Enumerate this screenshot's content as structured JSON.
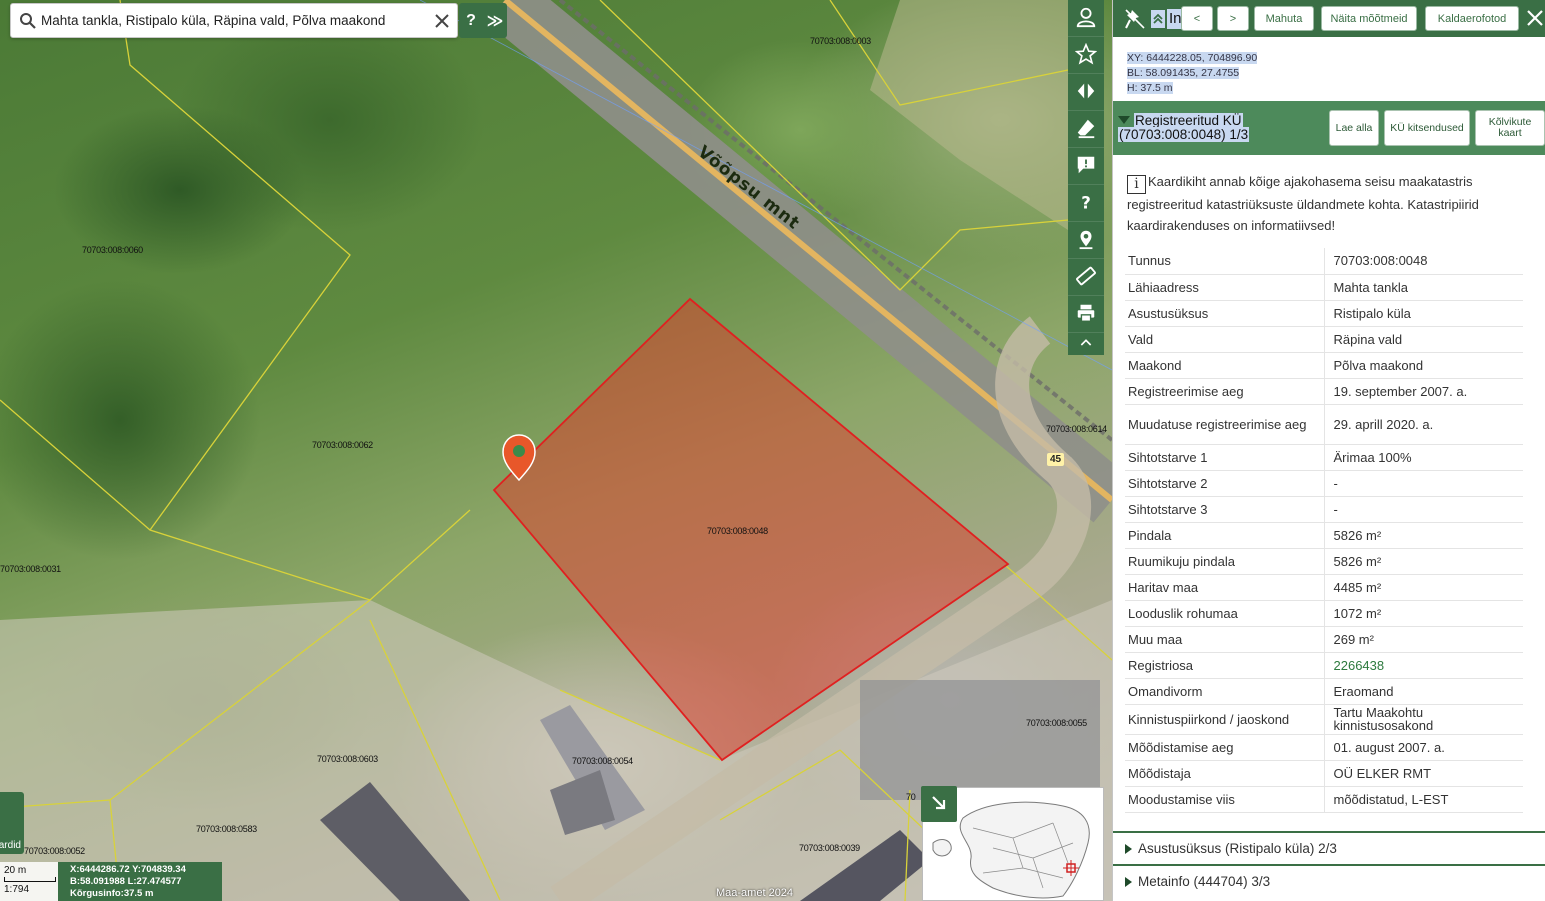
{
  "search": {
    "value": "Mahta tankla, Ristipalo küla, Räpina vald, Põlva maakond",
    "help": "?",
    "expand": "≫"
  },
  "map": {
    "road_name": "Võõpsu mnt",
    "road_number": "45",
    "attribution": "Maa-amet 2024",
    "parcels": [
      "70703:008:0003",
      "70703:008:0060",
      "70703:008:0062",
      "70703:008:0614",
      "70703:008:0048",
      "70703:008:0031",
      "70703:008:0603",
      "70703:008:0054",
      "70703:008:0055",
      "70703:008:0583",
      "70703:008:0052",
      "70703:008:0039",
      "70"
    ],
    "selected_parcel_color": "#e03a2a",
    "marker_color": "#e8572a"
  },
  "scale": {
    "label": "20 m",
    "ratio": "1:794"
  },
  "coords": {
    "xy": "X:6444286.72 Y:704839.34",
    "bl": "B:58.091988 L:27.474577",
    "height": "Kõrgusinfo:37.5 m"
  },
  "layers_button": "ardid",
  "toolbar": {
    "icons": [
      "user-icon",
      "star-icon",
      "swap-icon",
      "eraser-icon",
      "feedback-icon",
      "help-icon",
      "location-icon",
      "ruler-icon",
      "print-icon",
      "collapse-icon"
    ]
  },
  "panel": {
    "title": "In",
    "prev": "<",
    "next": ">",
    "fit": "Mahuta",
    "measure": "Näita mõõtmeid",
    "oblique": "Kaldaerofotod",
    "xy": "XY: 6444228.05, 704896.90",
    "bl": "BL: 58.091435, 27.4755",
    "h": "H: 37.5 m",
    "section_title_1": "Registreeritud KÜ",
    "section_title_2": "(70703:008:0048) 1/3",
    "download": "Lae alla",
    "restrictions": "KÜ kitsendused",
    "map_btn": "Kõlvikute kaart",
    "notice": "Kaardikiht annab kõige ajakohasema seisu maakatastris registreeritud katastriüksuste üldandmete kohta. Katastripiirid kaardirakenduses on informatiivsed!",
    "rows": [
      {
        "k": "Tunnus",
        "v": "70703:008:0048"
      },
      {
        "k": "Lähiaadress",
        "v": "Mahta tankla"
      },
      {
        "k": "Asustusüksus",
        "v": "Ristipalo küla"
      },
      {
        "k": "Vald",
        "v": "Räpina vald"
      },
      {
        "k": "Maakond",
        "v": "Põlva maakond"
      },
      {
        "k": "Registreerimise aeg",
        "v": "19. september 2007. a."
      },
      {
        "k": "Muudatuse registreerimise aeg",
        "v": "29. aprill 2020. a."
      },
      {
        "k": "Sihtotstarve 1",
        "v": "Ärimaa 100%"
      },
      {
        "k": "Sihtotstarve 2",
        "v": "-"
      },
      {
        "k": "Sihtotstarve 3",
        "v": "-"
      },
      {
        "k": "Pindala",
        "v": "5826 m²"
      },
      {
        "k": "Ruumikuju pindala",
        "v": "5826 m²"
      },
      {
        "k": "Haritav maa",
        "v": "4485 m²"
      },
      {
        "k": "Looduslik rohumaa",
        "v": "1072 m²"
      },
      {
        "k": "Muu maa",
        "v": "269 m²"
      },
      {
        "k": "Registriosa",
        "v": "2266438"
      },
      {
        "k": "Omandivorm",
        "v": "Eraomand"
      },
      {
        "k": "Kinnistuspiirkond / jaoskond",
        "v": "Tartu Maakohtu kinnistusosakond"
      },
      {
        "k": "Mõõdistamise aeg",
        "v": "01. august 2007. a."
      },
      {
        "k": "Mõõdistaja",
        "v": "OÜ ELKER RMT"
      },
      {
        "k": "Moodustamise viis",
        "v": "mõõdistatud, L-EST"
      }
    ],
    "collapsed_1": "Asustusüksus (Ristipalo küla) 2/3",
    "collapsed_2": "Metainfo (444704) 3/3"
  },
  "colors": {
    "accent": "#3a6f45",
    "section": "#4d8a5b",
    "highlight": "#c8d8f0",
    "link": "#2d7a3e"
  }
}
